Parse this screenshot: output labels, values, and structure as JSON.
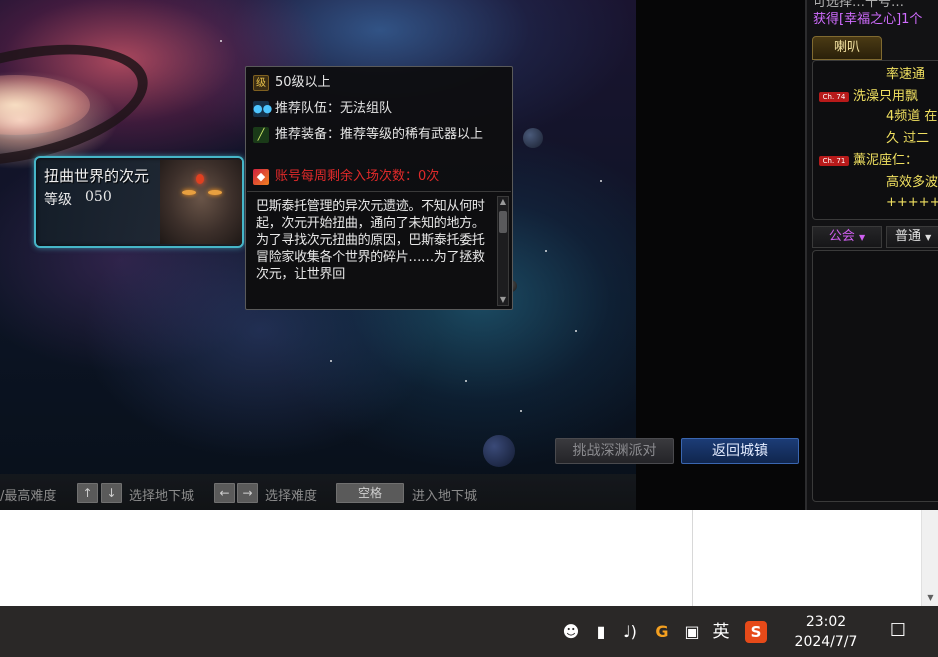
{
  "dungeon": {
    "name": "扭曲世界的次元",
    "level_label": "等级",
    "level": "050"
  },
  "tooltip": {
    "level_icon": "级",
    "level_req": "50级以上",
    "team_label": "推荐队伍：无法组队",
    "equip_label": "推荐装备：推荐等级的稀有武器以上",
    "entry_label": "账号每周剩余入场次数：0次",
    "description": "巴斯泰托管理的异次元遗迹。不知从何时起，次元开始扭曲，通向了未知的地方。为了寻找次元扭曲的原因，巴斯泰托委托冒险家收集各个世界的碎片……为了拯救次元，让世界回"
  },
  "buttons": {
    "challenge": "挑战深渊派对",
    "return_town": "返回城镇"
  },
  "hint_bar": {
    "max_difficulty": "/最高难度",
    "key_up": "↑",
    "key_down": "↓",
    "select_dungeon": "选择地下城",
    "key_left": "←",
    "key_right": "→",
    "select_difficulty": "选择难度",
    "key_space": "空格",
    "enter_dungeon": "进入地下城"
  },
  "chat": {
    "top_line1": "可选择…十号…",
    "top_line2": "获得[幸福之心]1个",
    "tab_horn": "喇叭",
    "lines": [
      {
        "badge": "",
        "text": "率速通",
        "color": "#f0e060",
        "indent": 73
      },
      {
        "badge": "Ch. 74",
        "text": "洗澡只用飘",
        "color": "#f0e060",
        "indent": 0
      },
      {
        "badge": "",
        "text": "4频道 在",
        "color": "#f0e060",
        "indent": 73
      },
      {
        "badge": "",
        "text": "久 过二",
        "color": "#f0e060",
        "indent": 73
      },
      {
        "badge": "Ch. 71",
        "text": "薰泥座仁：",
        "color": "#f0e060",
        "indent": 0
      },
      {
        "badge": "",
        "text": "高效多波",
        "color": "#f0e060",
        "indent": 73
      },
      {
        "badge": "",
        "text": "+++++++录",
        "color": "#f0e060",
        "indent": 73
      }
    ],
    "tab_guild": "公会",
    "tab_normal": "普通"
  },
  "taskbar": {
    "ime_lang": "英",
    "sogou": "S",
    "time": "23:02",
    "date": "2024/7/7"
  }
}
